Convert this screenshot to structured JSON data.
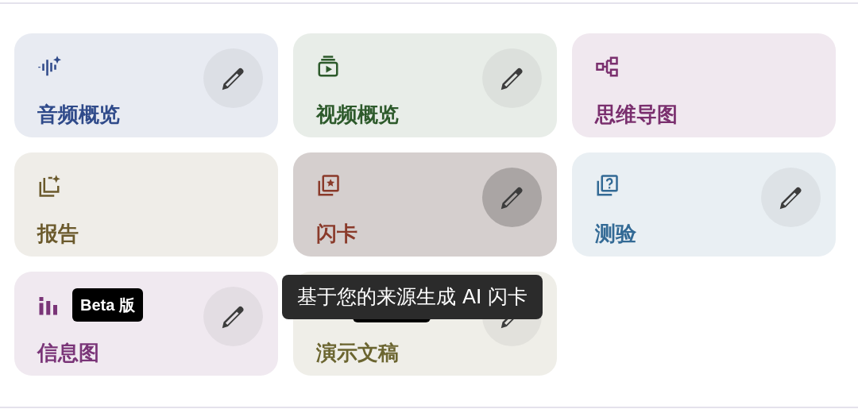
{
  "cards": [
    {
      "label": "音频概览",
      "kind": "audio",
      "color": "#2f4a8a",
      "edit_button": true,
      "hovered": false
    },
    {
      "label": "视频概览",
      "kind": "video",
      "color": "#2d5a2b",
      "edit_button": true,
      "hovered": false
    },
    {
      "label": "思维导图",
      "kind": "mindmap",
      "color": "#7a2f6e",
      "edit_button": false,
      "hovered": false
    },
    {
      "label": "报告",
      "kind": "report",
      "color": "#6b5a2c",
      "edit_button": false,
      "hovered": false
    },
    {
      "label": "闪卡",
      "kind": "flashcard",
      "color": "#8a3a2a",
      "edit_button": true,
      "hovered": true
    },
    {
      "label": "测验",
      "kind": "quiz",
      "color": "#336a95",
      "edit_button": true,
      "hovered": false
    },
    {
      "label": "信息图",
      "kind": "chart",
      "color": "#7a3578",
      "edit_button": true,
      "hovered": false,
      "badge": "Beta 版"
    },
    {
      "label": "演示文稿",
      "kind": "slides",
      "color": "#6b6530",
      "edit_button": true,
      "hovered": false,
      "covered_badge": true
    }
  ],
  "tooltip": "基于您的来源生成 AI 闪卡"
}
